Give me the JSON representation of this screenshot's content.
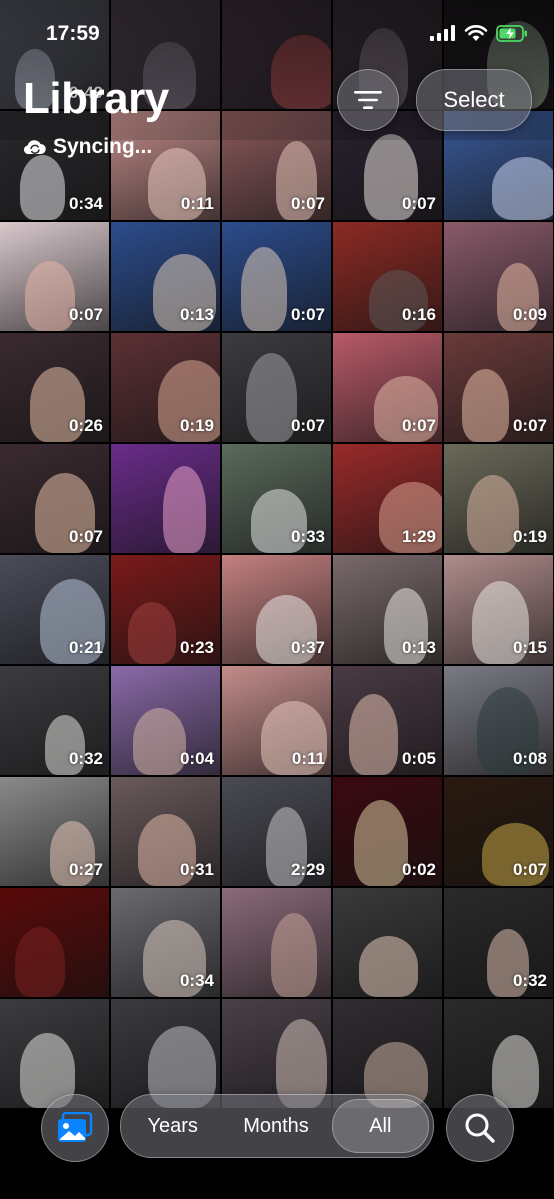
{
  "status_bar": {
    "time": "17:59"
  },
  "header": {
    "title": "Library",
    "sync_status": "Syncing...",
    "select_label": "Select"
  },
  "icons": {
    "sort": "sort-icon",
    "albums": "photo-albums-icon",
    "search": "search-icon",
    "cloud_sync": "cloud-sync-icon",
    "signal": "signal-icon",
    "wifi": "wifi-icon",
    "battery": "battery-charging-icon"
  },
  "colors": {
    "accent": "#0a84ff",
    "battery_green": "#4cd964"
  },
  "view_switcher": {
    "options": [
      "Years",
      "Months",
      "All"
    ],
    "selected": "All"
  },
  "grid": {
    "tiles": [
      {
        "duration": "0:49",
        "bg": "#6b6f7d",
        "fig": "#c9cfe0"
      },
      {
        "duration": "",
        "bg": "#5a4a5c",
        "fig": "#8a8290"
      },
      {
        "duration": "",
        "bg": "#4a3a4a",
        "fig": "#c05050"
      },
      {
        "duration": "",
        "bg": "#3f3540",
        "fig": "#8a7c86"
      },
      {
        "duration": "",
        "bg": "#1e1a1e",
        "fig": "#a4b8a0"
      },
      {
        "duration": "0:34",
        "bg": "#2a2a2e",
        "fig": "#e8e6ea"
      },
      {
        "duration": "0:11",
        "bg": "#c28c8a",
        "fig": "#e9c9c0"
      },
      {
        "duration": "0:07",
        "bg": "#8c5a5c",
        "fig": "#e4c2b8"
      },
      {
        "duration": "0:07",
        "bg": "#2a2230",
        "fig": "#e8e0dc"
      },
      {
        "duration": "",
        "bg": "#3a5a9a",
        "fig": "#c8d4ee"
      },
      {
        "duration": "0:07",
        "bg": "#d8c8cc",
        "fig": "#e8b4a8"
      },
      {
        "duration": "0:13",
        "bg": "#2c4c8c",
        "fig": "#dccab8"
      },
      {
        "duration": "0:07",
        "bg": "#2c4c8c",
        "fig": "#dccab8"
      },
      {
        "duration": "0:16",
        "bg": "#8c2a24",
        "fig": "#5a5a5a"
      },
      {
        "duration": "0:09",
        "bg": "#8a5a6a",
        "fig": "#e4b8a4"
      },
      {
        "duration": "0:26",
        "bg": "#3a2a30",
        "fig": "#e8c0a8"
      },
      {
        "duration": "0:19",
        "bg": "#5c3034",
        "fig": "#d8a894"
      },
      {
        "duration": "0:07",
        "bg": "#3c3c40",
        "fig": "#a0a0a4"
      },
      {
        "duration": "0:07",
        "bg": "#b85a68",
        "fig": "#e4b8a8"
      },
      {
        "duration": "0:07",
        "bg": "#6a3a3a",
        "fig": "#e4bca4"
      },
      {
        "duration": "0:07",
        "bg": "#3a2a30",
        "fig": "#e8c0a8"
      },
      {
        "duration": "",
        "bg": "#6a2c8a",
        "fig": "#e8a0c8"
      },
      {
        "duration": "0:33",
        "bg": "#5a6a5c",
        "fig": "#e4e4e4"
      },
      {
        "duration": "1:29",
        "bg": "#9a2a2a",
        "fig": "#d8a090"
      },
      {
        "duration": "0:19",
        "bg": "#6a6a5a",
        "fig": "#d8b4a0"
      },
      {
        "duration": "0:21",
        "bg": "#4a4c5a",
        "fig": "#b8c4d8"
      },
      {
        "duration": "0:23",
        "bg": "#7a1a1a",
        "fig": "#a04040"
      },
      {
        "duration": "0:37",
        "bg": "#c48080",
        "fig": "#e8e8e4"
      },
      {
        "duration": "0:13",
        "bg": "#7a6a6a",
        "fig": "#e8e6e2"
      },
      {
        "duration": "0:15",
        "bg": "#b08c8c",
        "fig": "#e8e6e2"
      },
      {
        "duration": "0:32",
        "bg": "#3c3c40",
        "fig": "#e0e0dc"
      },
      {
        "duration": "0:04",
        "bg": "#8a6aa8",
        "fig": "#d4b4a4"
      },
      {
        "duration": "0:11",
        "bg": "#c28c8a",
        "fig": "#e9c9c0"
      },
      {
        "duration": "0:05",
        "bg": "#4a3a44",
        "fig": "#e4c0b0"
      },
      {
        "duration": "0:08",
        "bg": "#7a7a84",
        "fig": "#2a3a3a"
      },
      {
        "duration": "0:27",
        "bg": "#8a8a8c",
        "fig": "#e4c4b4"
      },
      {
        "duration": "0:31",
        "bg": "#6a5a5c",
        "fig": "#e0b8a8"
      },
      {
        "duration": "2:29",
        "bg": "#4a4a54",
        "fig": "#c4c4c8"
      },
      {
        "duration": "0:02",
        "bg": "#3a0a10",
        "fig": "#d8c8a0"
      },
      {
        "duration": "0:07",
        "bg": "#2a1a10",
        "fig": "#c8a848"
      },
      {
        "duration": "",
        "bg": "#5a0a0a",
        "fig": "#7a2020"
      },
      {
        "duration": "0:34",
        "bg": "#6a6a70",
        "fig": "#d8c8c0"
      },
      {
        "duration": "",
        "bg": "#8a6a7a",
        "fig": "#c4a498"
      },
      {
        "duration": "",
        "bg": "#3a3a3c",
        "fig": "#e4c8b8"
      },
      {
        "duration": "0:32",
        "bg": "#2a2a2c",
        "fig": "#d8bcac"
      },
      {
        "duration": "",
        "bg": "#3c3c40",
        "fig": "#e0e0dc"
      },
      {
        "duration": "",
        "bg": "#3a3a40",
        "fig": "#c0c0c4"
      },
      {
        "duration": "",
        "bg": "#4a4048",
        "fig": "#d0c0b8"
      },
      {
        "duration": "",
        "bg": "#302c30",
        "fig": "#c8b0a0"
      },
      {
        "duration": "",
        "bg": "#2a2a2c",
        "fig": "#e0ded8"
      }
    ]
  }
}
